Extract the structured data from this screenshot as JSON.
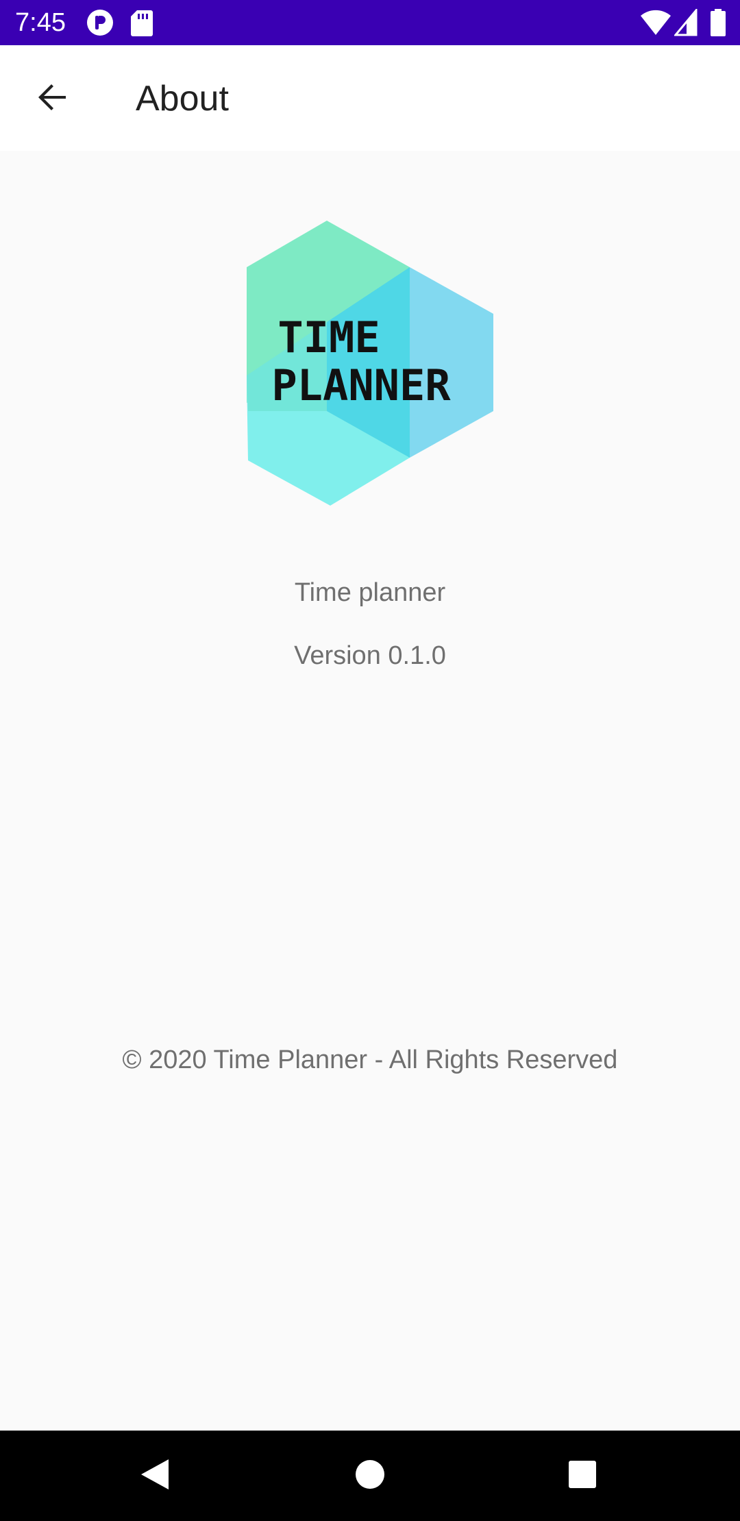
{
  "status_bar": {
    "time": "7:45",
    "background_color": "#3a00b3",
    "icons": [
      "notification-p-icon",
      "sd-card-icon",
      "wifi-icon",
      "signal-icon",
      "battery-icon"
    ]
  },
  "toolbar": {
    "back_icon": "arrow-back-icon",
    "title": "About"
  },
  "logo": {
    "line1": "TIME",
    "line2": "PLANNER",
    "colors": [
      "#7ee8c5",
      "#82d8f0",
      "#7ff0ee",
      "#4ed6e6"
    ]
  },
  "app_info": {
    "name": "Time planner",
    "version": "Version 0.1.0"
  },
  "footer": {
    "copyright": "© 2020 Time Planner - All Rights Reserved"
  },
  "nav_bar": {
    "back": "nav-back-icon",
    "home": "nav-home-icon",
    "recents": "nav-recents-icon"
  }
}
